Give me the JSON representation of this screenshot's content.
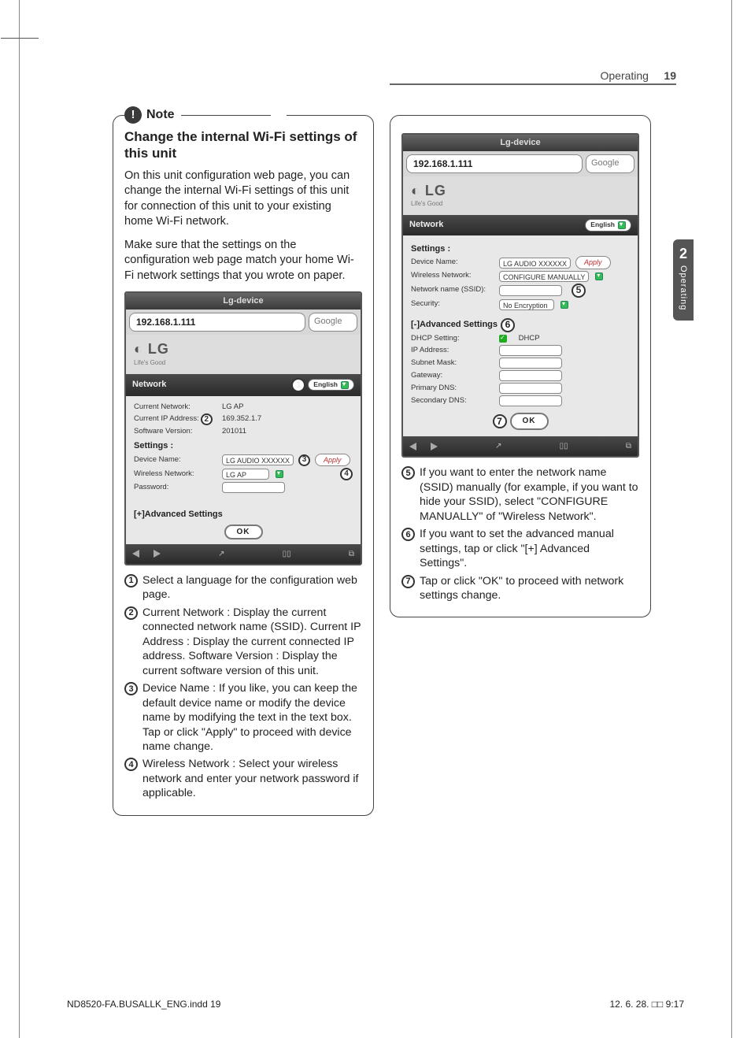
{
  "header": {
    "section": "Operating",
    "page": "19"
  },
  "side_tab": {
    "chapter": "2",
    "label": "Operating"
  },
  "note_label": "Note",
  "left": {
    "subhead": "Change the internal Wi-Fi settings of this unit",
    "p1": "On this unit configuration web page, you can change the internal Wi-Fi settings of this unit for connection of this unit to your existing home Wi-Fi network.",
    "p2": "Make sure that the settings on the configuration web page match your home Wi-Fi network settings that you wrote on paper.",
    "ss": {
      "title": "Lg-device",
      "addr": "192.168.1.111",
      "search": "Google",
      "brand": "LG",
      "brand_sub": "Life's Good",
      "nav": "Network",
      "lang": "English",
      "current_network_lab": "Current Network:",
      "current_network_val": "LG AP",
      "current_ip_lab": "Current IP Address:",
      "current_ip_val": "169.352.1.7",
      "sw_ver_lab": "Software Version:",
      "sw_ver_val": "201011",
      "settings_lab": "Settings :",
      "devname_lab": "Device Name:",
      "devname_val": "LG AUDIO XXXXXX",
      "apply": "Apply",
      "wnet_lab": "Wireless Network:",
      "wnet_val": "LG AP",
      "pwd_lab": "Password:",
      "adv": "[+]Advanced Settings",
      "ok": "OK"
    },
    "items": {
      "1": "Select a language for the configuration web page.",
      "2": "Current Network : Display the current connected network name (SSID). Current IP Address : Display the current connected IP address. Software Version : Display the current software version of this unit.",
      "3": "Device Name : If you like, you can keep the default device name or modify the device name by modifying the text in the text box. Tap or click \"Apply\" to proceed with device name change.",
      "4": "Wireless Network : Select your wireless network and enter your network password if applicable."
    }
  },
  "right": {
    "ss": {
      "title": "Lg-device",
      "addr": "192.168.1.111",
      "search": "Google",
      "brand": "LG",
      "brand_sub": "Life's Good",
      "nav": "Network",
      "lang": "English",
      "settings_lab": "Settings :",
      "devname_lab": "Device Name:",
      "devname_val": "LG AUDIO XXXXXX",
      "apply": "Apply",
      "wnet_lab": "Wireless Network:",
      "wnet_val": "CONFIGURE MANUALLY",
      "ssid_lab": "Network name (SSID):",
      "sec_lab": "Security:",
      "sec_val": "No Encryption",
      "adv": "[-]Advanced Settings",
      "dhcp_lab": "DHCP Setting:",
      "dhcp_val": "DHCP",
      "ip_lab": "IP Address:",
      "mask_lab": "Subnet Mask:",
      "gw_lab": "Gateway:",
      "dns1_lab": "Primary DNS:",
      "dns2_lab": "Secondary DNS:",
      "ok": "OK"
    },
    "items": {
      "5": "If you want to enter the network name (SSID) manually (for example, if you want to hide your SSID), select \"CONFIGURE MANUALLY\" of \"Wireless Network\".",
      "6": "If you want to set the advanced manual settings, tap or click \"[+] Advanced Settings\".",
      "7": "Tap or click \"OK\" to proceed with network settings change."
    }
  },
  "footer": {
    "file": "ND8520-FA.BUSALLK_ENG.indd   19",
    "stamp": "12. 6. 28.   □□ 9:17"
  }
}
